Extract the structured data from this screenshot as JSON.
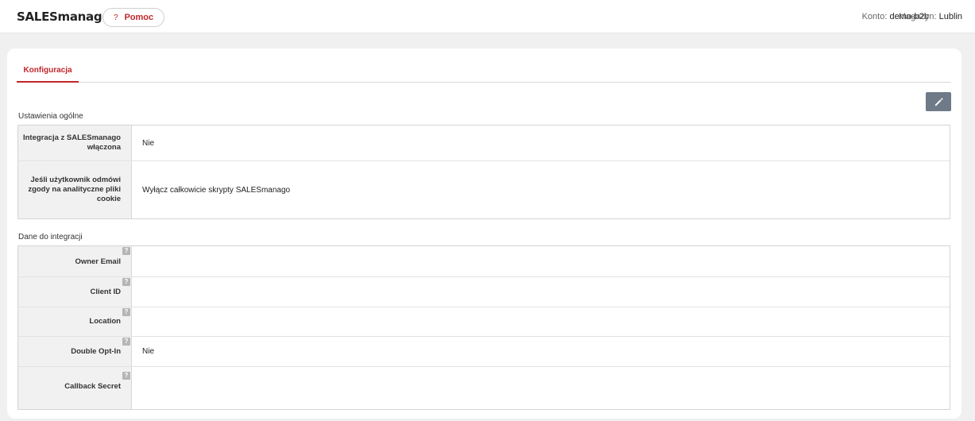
{
  "header": {
    "app_title": "SALESmanago",
    "help_label": "Pomoc",
    "help_icon": "?",
    "account_label": "Konto:",
    "account_value": "demo-b2b",
    "store_label": "Magazyn:",
    "store_value": "Lublin"
  },
  "tabs": [
    {
      "label": "Konfiguracja",
      "active": true
    }
  ],
  "edit_button": {
    "icon": "pencil-icon"
  },
  "general": {
    "title": "Ustawienia ogólne",
    "rows": [
      {
        "label": "Integracja z SALESmanago włączona",
        "value": "Nie"
      },
      {
        "label": "Jeśli użytkownik odmówi zgody na analityczne pliki cookie",
        "value": "Wyłącz całkowicie skrypty SALESmanago"
      }
    ]
  },
  "integration": {
    "title": "Dane do integracji",
    "tooltip_icon": "?",
    "rows": [
      {
        "label": "Owner Email",
        "value": ""
      },
      {
        "label": "Client ID",
        "value": ""
      },
      {
        "label": "Location",
        "value": ""
      },
      {
        "label": "Double Opt-In",
        "value": "Nie"
      },
      {
        "label": "Callback Secret",
        "value": ""
      }
    ]
  },
  "colors": {
    "accent": "#c0262d",
    "edit_button_bg": "#6e7a87",
    "label_bg": "#f1f1f1"
  }
}
